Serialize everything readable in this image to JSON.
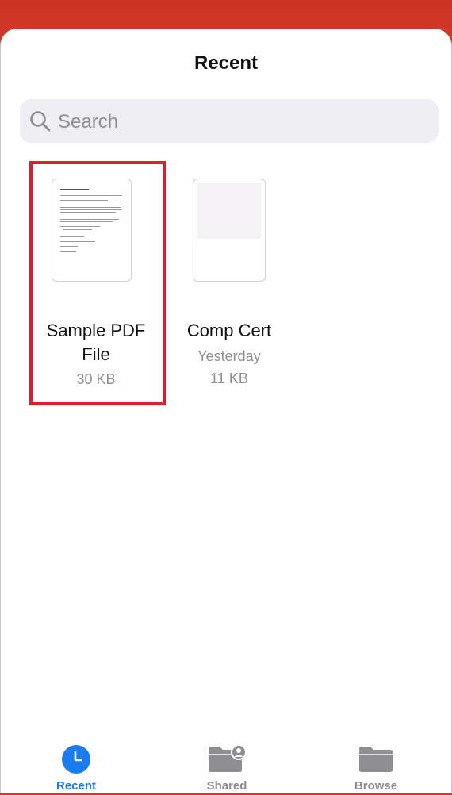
{
  "header": {
    "title": "Recent"
  },
  "search": {
    "placeholder": "Search"
  },
  "files": [
    {
      "name_line1": "Sample PDF",
      "name_line2": "File",
      "size": "30 KB"
    },
    {
      "name_line1": "Comp Cert",
      "date": "Yesterday",
      "size": "11 KB"
    }
  ],
  "tabs": [
    {
      "label": "Recent",
      "icon": "clock-icon",
      "active": true
    },
    {
      "label": "Shared",
      "icon": "shared-folder-icon",
      "active": false
    },
    {
      "label": "Browse",
      "icon": "folder-icon",
      "active": false
    }
  ],
  "colors": {
    "accent": "#1a7cf0",
    "inactive": "#8e8e93",
    "highlight": "#e01e2b",
    "header_red": "#d33a2c"
  }
}
